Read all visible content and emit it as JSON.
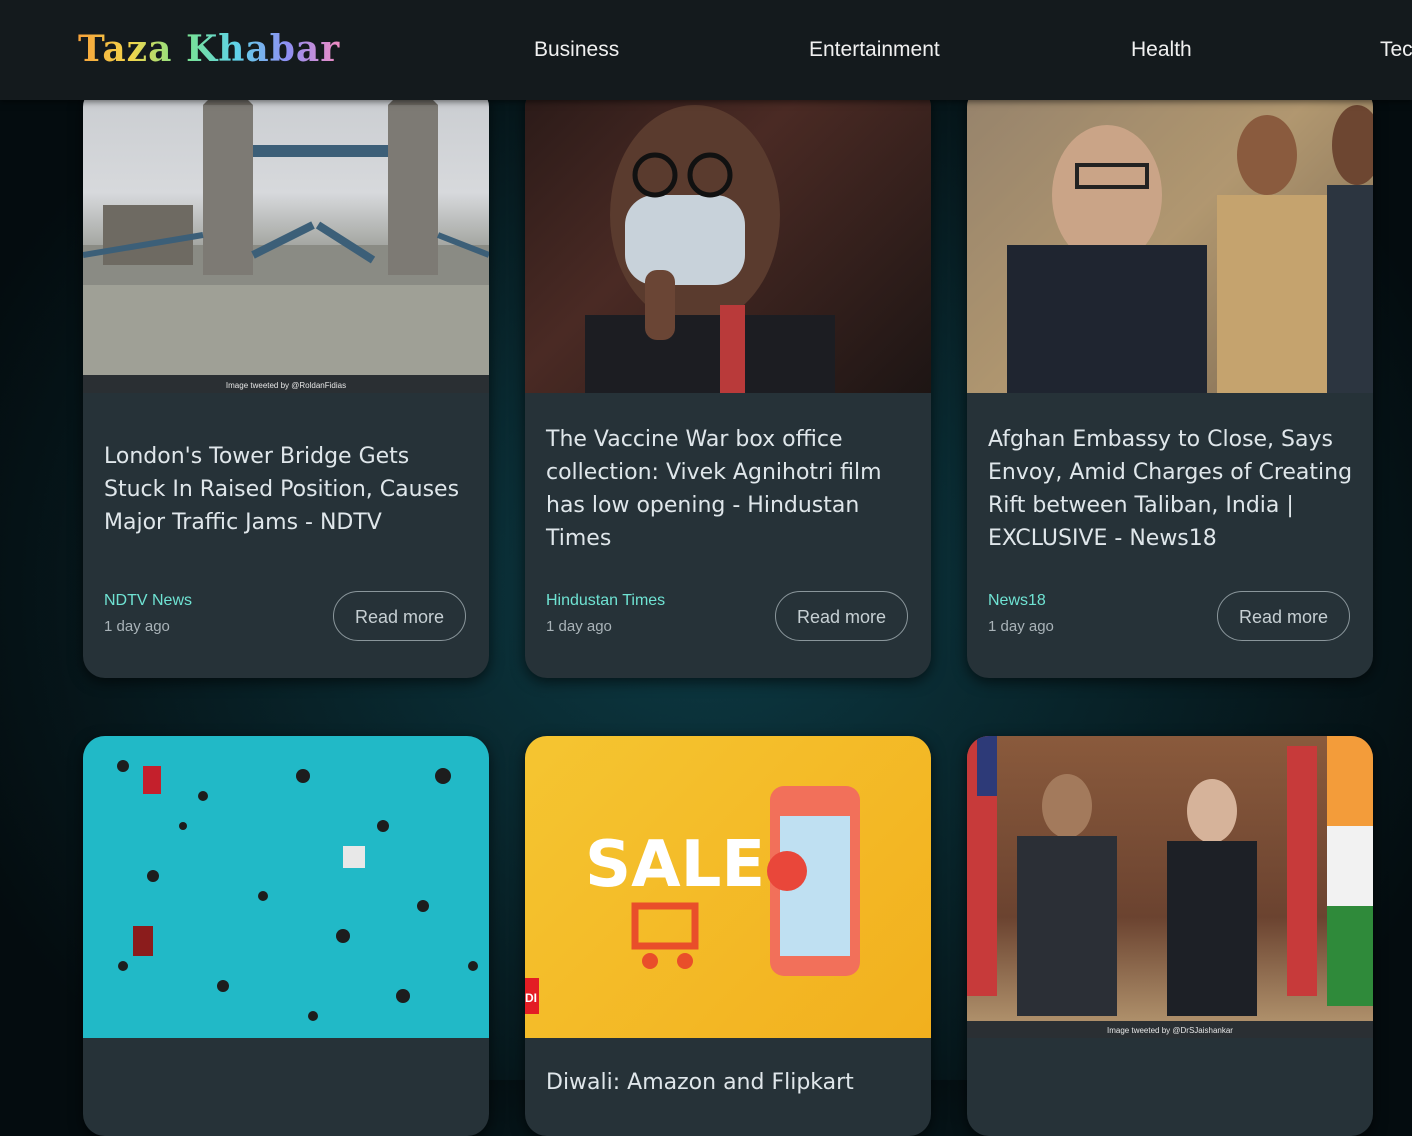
{
  "brand": "Taza Khabar",
  "nav": [
    "Business",
    "Entertainment",
    "Health",
    "Tec"
  ],
  "read_more": "Read more",
  "cards": [
    {
      "title": "London's Tower Bridge Gets Stuck In Raised Position, Causes Major Traffic Jams - NDTV",
      "source": "NDTV News",
      "time": "1 day ago",
      "image_credit": "Image tweeted by @RoldanFidias"
    },
    {
      "title": "The Vaccine War box office collection: Vivek Agnihotri film has low opening - Hindustan Times",
      "source": "Hindustan Times",
      "time": "1 day ago"
    },
    {
      "title": "Afghan Embassy to Close, Says Envoy, Amid Charges of Creating Rift between Taliban, India | EXCLUSIVE - News18",
      "source": "News18",
      "time": "1 day ago"
    },
    {
      "title": ""
    },
    {
      "title": "Diwali: Amazon and Flipkart",
      "badge": "DI"
    },
    {
      "title": "",
      "image_credit": "Image tweeted by @DrSJaishankar"
    }
  ]
}
